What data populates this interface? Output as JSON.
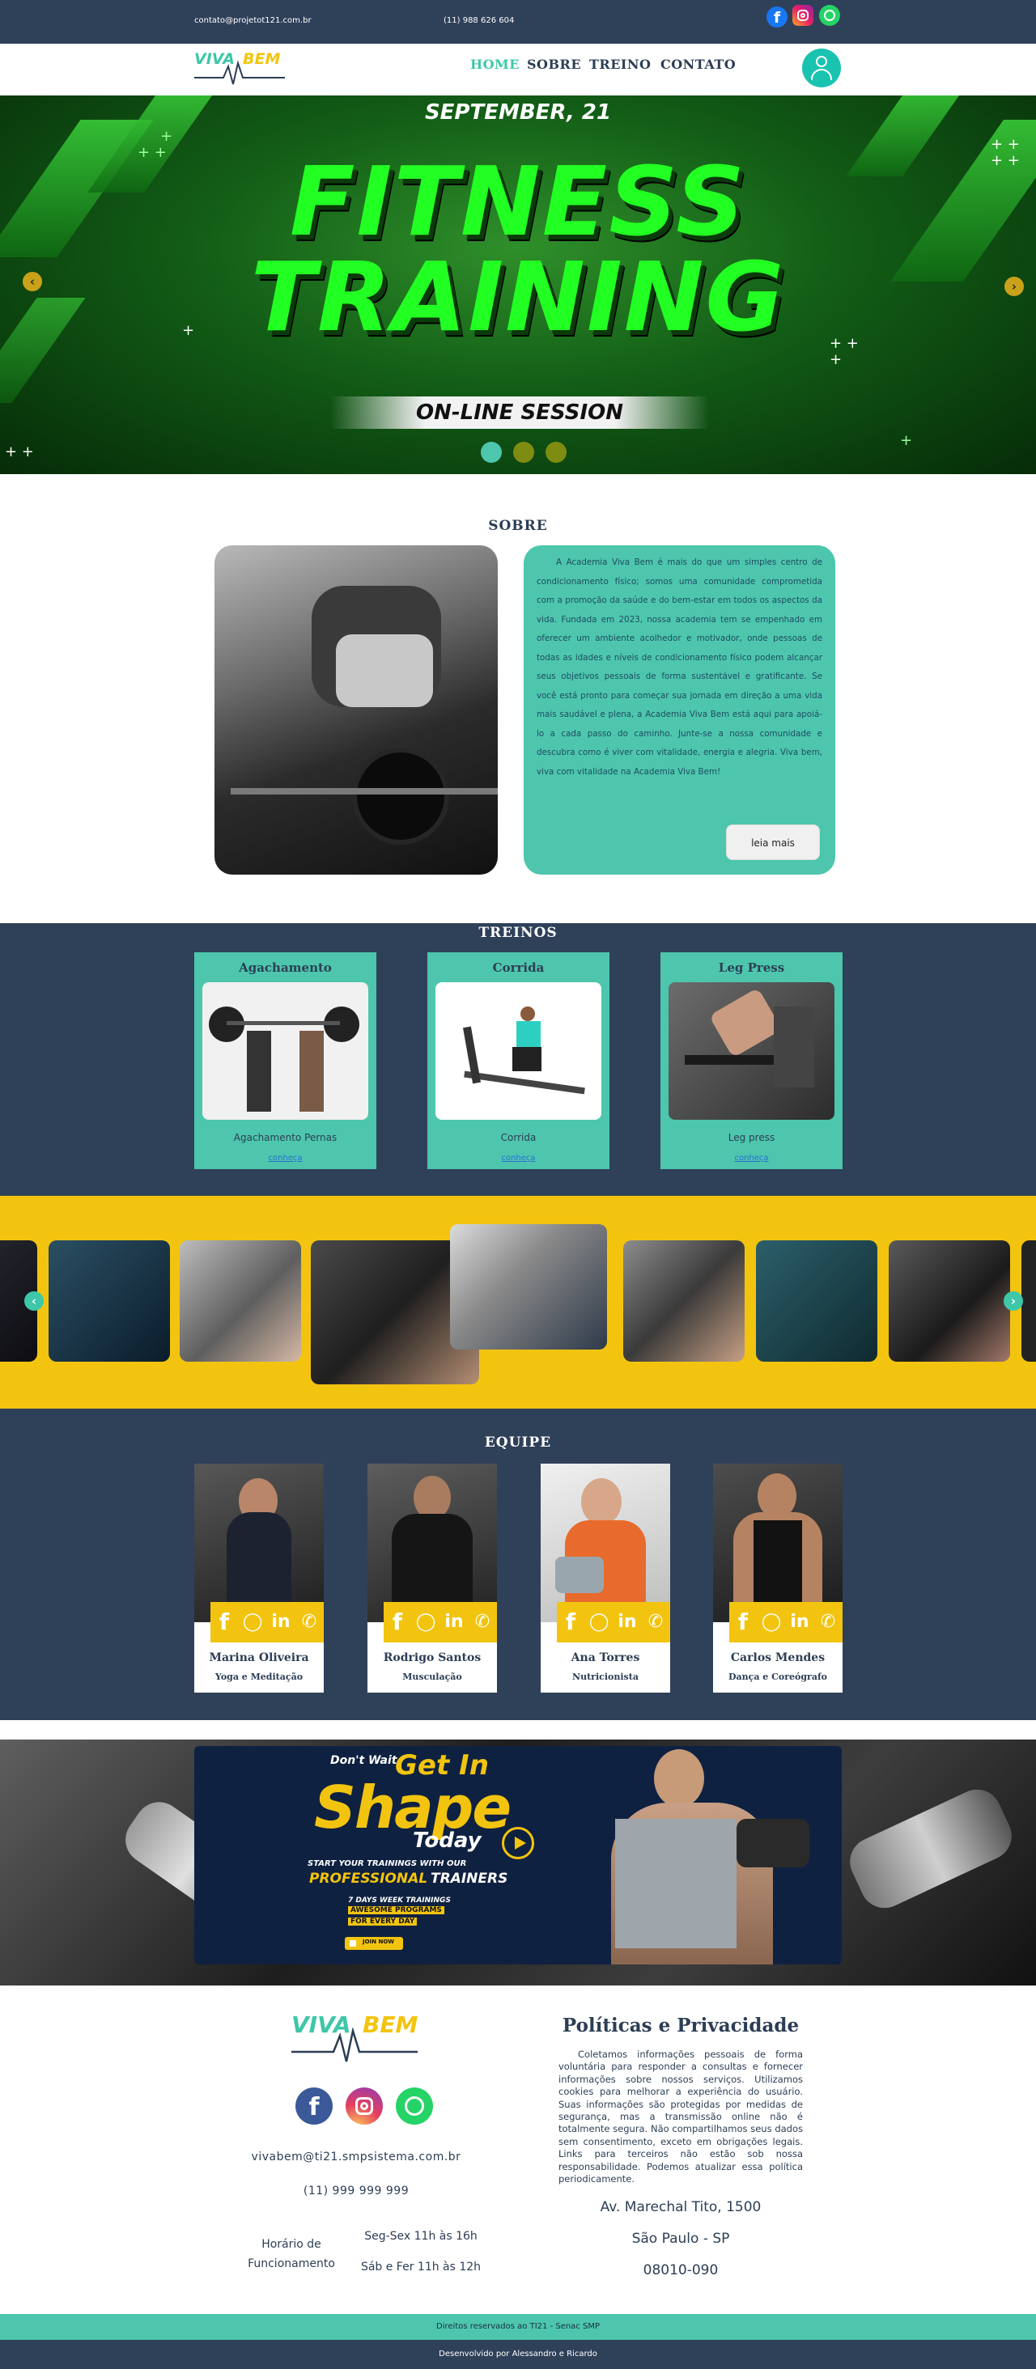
{
  "topbar": {
    "email": "contato@projetot121.com.br",
    "phone": "(11) 988 626 604",
    "icons": [
      "facebook-icon",
      "instagram-icon",
      "whatsapp-icon"
    ]
  },
  "nav": {
    "logo_viva": "VIVA",
    "logo_bem": "BEM",
    "links": [
      "HOME",
      "SOBRE",
      "TREINO",
      "CONTATO"
    ],
    "active": "HOME",
    "user_icon": "user-icon"
  },
  "hero": {
    "date": "SEPTEMBER, 21",
    "line1": "FITNESS",
    "line2": "TRAINING",
    "session": "ON-LINE SESSION",
    "active_slide": 1,
    "slides": 3
  },
  "sobre": {
    "title": "SOBRE",
    "text": "A Academia Viva Bem é mais do que um simples centro de condicionamento físico; somos uma comunidade comprometida com a promoção da saúde e do bem-estar em todos os aspectos da vida. Fundada em 2023, nossa academia tem se empenhado em oferecer um ambiente acolhedor e motivador, onde pessoas de todas as idades e níveis de condicionamento físico podem alcançar seus objetivos pessoais de forma sustentável e gratificante. Se você está pronto para começar sua jornada em direção a uma vida mais saudável e plena, a Academia Viva Bem está aqui para apoiá-lo a cada passo do caminho. Junte-se a nossa comunidade e descubra como é viver com vitalidade, energia e alegria. Viva bem, viva com vitalidade na Academia Viva Bem!",
    "button": "leia mais"
  },
  "treinos": {
    "title": "TREINOS",
    "cards": [
      {
        "title": "Agachamento",
        "desc": "Agachamento Pernas",
        "link": "conheça"
      },
      {
        "title": "Corrida",
        "desc": "Corrida",
        "link": "conheça"
      },
      {
        "title": "Leg Press",
        "desc": "Leg press",
        "link": "conheça"
      }
    ]
  },
  "equipe": {
    "title": "EQUIPE",
    "members": [
      {
        "name": "Marina Oliveira",
        "role": "Yoga e Meditação"
      },
      {
        "name": "Rodrigo Santos",
        "role": "Musculação"
      },
      {
        "name": "Ana Torres",
        "role": "Nutricionista"
      },
      {
        "name": "Carlos Mendes",
        "role": "Dança e Coreógrafo"
      }
    ]
  },
  "promo": {
    "dont_wait": "Don't Wait",
    "get_in": "Get In",
    "shape": "Shape",
    "today": "Today",
    "start": "START YOUR TRAININGS WITH OUR",
    "professional": "PROFESSIONAL",
    "trainers": "TRAINERS",
    "days": "7 DAYS WEEK TRAININGS",
    "awesome": "AWESOME PROGRAMS",
    "every": "FOR EVERY DAY",
    "join": "JOIN NOW"
  },
  "footer": {
    "email": "vivabem@ti21.smpsistema.com.br",
    "phone": "(11) 999 999 999",
    "hours_label_1": "Horário de",
    "hours_label_2": "Funcionamento",
    "hours_1": "Seg-Sex 11h às 16h",
    "hours_2": "Sáb e Fer 11h às 12h",
    "policy_title": "Políticas e Privacidade",
    "policy_text": "Coletamos informações pessoais de forma voluntária para responder a consultas e fornecer informações sobre nossos serviços. Utilizamos cookies para melhorar a experiência do usuário. Suas informações são protegidas por medidas de segurança, mas a transmissão online não é totalmente segura. Não compartilhamos seus dados sem consentimento, exceto em obrigações legais. Links para terceiros não estão sob nossa responsabilidade. Podemos atualizar essa política periodicamente.",
    "address_1": "Av. Marechal Tito, 1500",
    "address_2": "São Paulo - SP",
    "address_3": "08010-090",
    "rights": "Direitos reservados ao TI21 - Senac SMP",
    "dev": "Desenvolvido por Alessandro e Ricardo"
  },
  "colors": {
    "navy": "#2f4059",
    "teal": "#4dc6ad",
    "yellow": "#f2c40f",
    "green": "#22ff22"
  }
}
